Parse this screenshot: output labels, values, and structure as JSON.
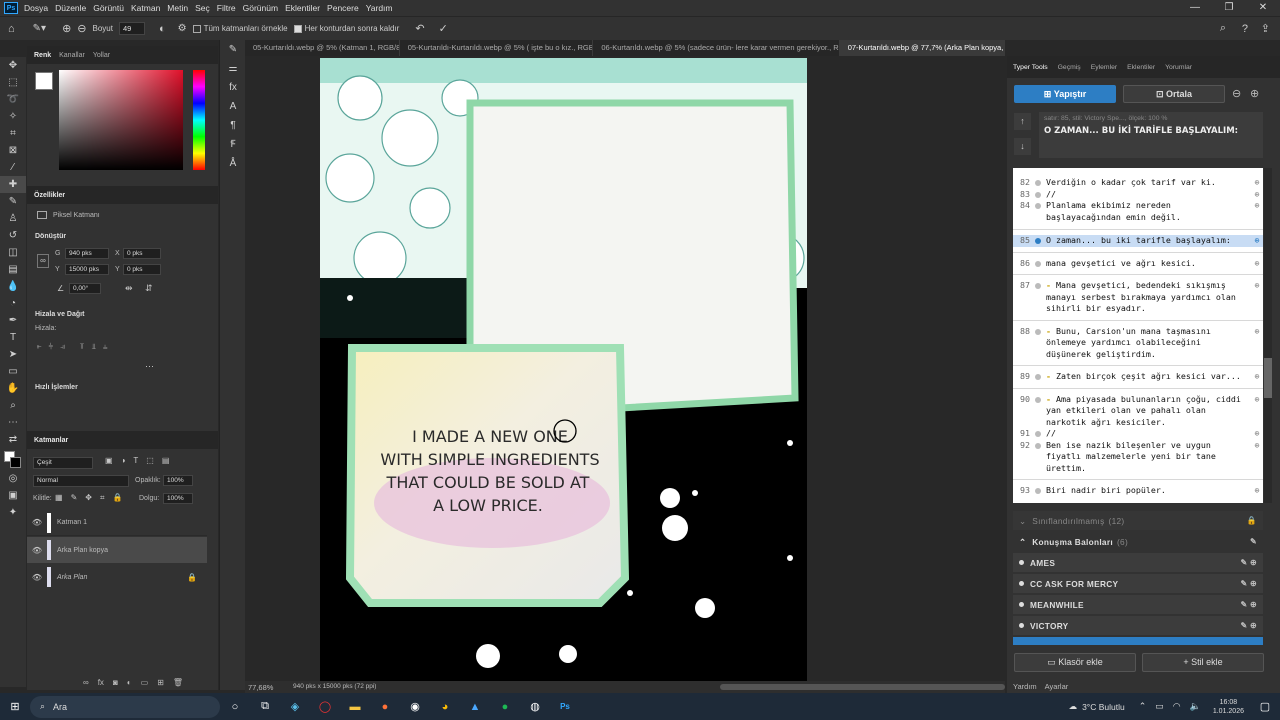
{
  "menubar": {
    "app_badge": "Ps",
    "items": [
      "Dosya",
      "Düzenle",
      "Görüntü",
      "Katman",
      "Metin",
      "Seç",
      "Filtre",
      "Görünüm",
      "Eklentiler",
      "Pencere",
      "Yardım"
    ],
    "window_controls": [
      "—",
      "❐",
      "✕"
    ]
  },
  "options_bar": {
    "size_label": "Boyut",
    "size_value": "49",
    "sample_all_label": "Tüm katmanları örnekle",
    "after_contour_label": "Her konturdan sonra kaldır"
  },
  "left_panel": {
    "color_tabs": [
      "Renk",
      "Kanallar",
      "Yollar"
    ],
    "properties_title": "Özellikler",
    "pixel_layer_label": "Piksel Katmanı",
    "transform_title": "Dönüştür",
    "w_label": "G",
    "w_value": "940 pks",
    "h_label": "Y",
    "h_value": "15000 pks",
    "x_label": "X",
    "x_value": "0 pks",
    "y_label": "Y",
    "y_value": "0 pks",
    "angle_value": "0,00°",
    "align_title": "Hizala ve Dağıt",
    "align_sub": "Hizala:",
    "quick_title": "Hızlı İşlemler",
    "layers_title": "Katmanlar",
    "filter_kind": "Çeşit",
    "blend_mode": "Normal",
    "opacity_label": "Opaklık:",
    "opacity_value": "100%",
    "lock_label": "Kilitle:",
    "fill_label": "Dolgu:",
    "fill_value": "100%",
    "layers": [
      {
        "name": "Katman 1"
      },
      {
        "name": "Arka Plan kopya"
      },
      {
        "name": "Arka Plan"
      }
    ]
  },
  "doc_tabs": [
    {
      "label": "05-Kurtarıldı.webp @ 5% (Katman 1, RGB/8#) *"
    },
    {
      "label": "05-Kurtarıldı-Kurtarıldı.webp @ 5% ( işte bu o kız., RGB/8#) *"
    },
    {
      "label": "06-Kurtarıldı.webp @ 5% (sadece ürün- lere karar vermen gerekiyor., RGB/8#) *"
    },
    {
      "label": "07-Kurtarıldı.webp @ 77,7% (Arka Plan kopya, RGB/8#) *"
    }
  ],
  "bubble_text": [
    "I MADE A NEW ONE",
    "WITH SIMPLE INGREDIENTS",
    "THAT COULD BE SOLD AT",
    "A LOW PRICE."
  ],
  "status": {
    "zoom": "77,68%",
    "doc_info": "940 pks x 15000 pks (72 ppi)"
  },
  "typer": {
    "tabs": [
      "Typer Tools",
      "Geçmiş",
      "Eylemler",
      "Eklentiler",
      "Yorumlar"
    ],
    "paste_btn": "Yapıştır",
    "center_btn": "Ortala",
    "current_info": "satır: 85, stil: Victory Spe..., ölçek: 100 %",
    "current_text": "O ZAMAN... BU İKİ TARİFLE BAŞLAYALIM:",
    "lines": [
      {
        "n": "82",
        "t": "Verdiğin o kadar çok tarif var ki."
      },
      {
        "n": "83",
        "t": "//"
      },
      {
        "n": "84",
        "t": "Planlama ekibimiz nereden\nbaşlayacağından emin değil."
      },
      {
        "n": "85",
        "t": "O zaman... bu iki tarifle başlayalım:"
      },
      {
        "n": "86",
        "t": "mana gevşetici ve ağrı kesici."
      },
      {
        "n": "87",
        "t": "Mana gevşetici, bedendeki sıkışmış\nmanayı serbest bırakmaya yardımcı olan\nsihirli bir esyadır."
      },
      {
        "n": "88",
        "t": "Bunu, Carsion'un mana taşmasını\nönlemeye yardımcı olabileceğini\ndüşünerek geliştirdim."
      },
      {
        "n": "89",
        "t": "Zaten birçok çeşit ağrı kesici var..."
      },
      {
        "n": "90",
        "t": "Ama piyasada bulunanların çoğu, ciddi\nyan etkileri olan ve pahalı olan\nnarkotik ağrı kesiciler."
      },
      {
        "n": "91",
        "t": "//"
      },
      {
        "n": "92",
        "t": "Ben ise nazik bileşenler ve uygun\nfiyatlı malzemelerle yeni bir tane\nürettim."
      },
      {
        "n": "93",
        "t": "Biri nadir biri popüler."
      }
    ],
    "groups": {
      "uncategorized": "Sınıflandırılmamış",
      "uncategorized_count": "(12)",
      "balloons": "Konuşma Balonları",
      "balloons_count": "(6)"
    },
    "styles": [
      "AMES",
      "CC ASK FOR MERCY",
      "MEANWHILE",
      "VICTORY"
    ],
    "folder_btn": "Klasör ekle",
    "style_btn": "Stil ekle",
    "bottom_tabs": [
      "Yardım",
      "Ayarlar"
    ]
  },
  "taskbar": {
    "search": "Ara",
    "weather": "3°C  Bulutlu",
    "time": "16:08",
    "date": "1.01.2026"
  }
}
